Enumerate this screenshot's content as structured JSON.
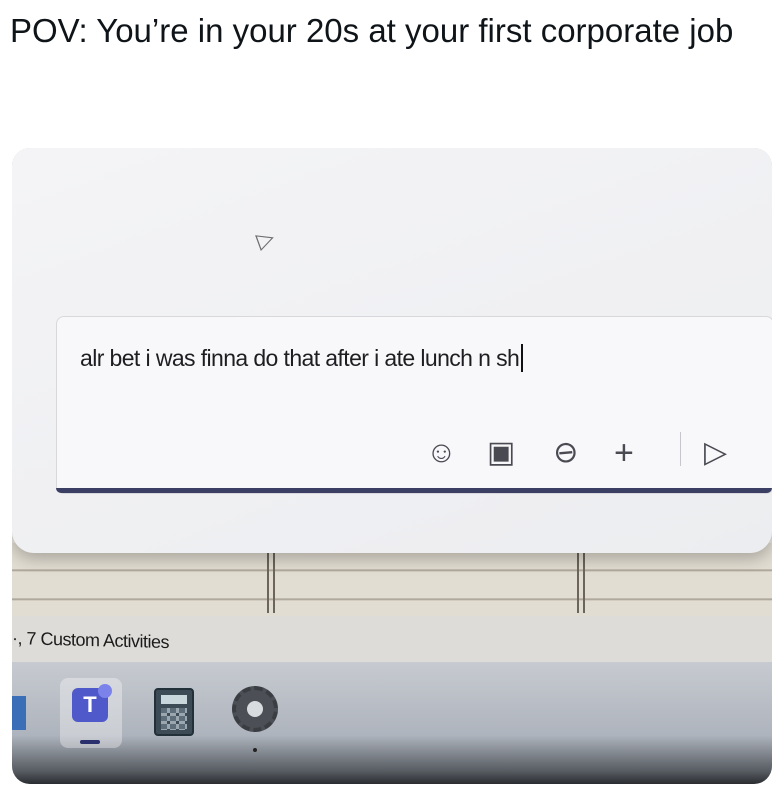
{
  "caption": "POV: You’re in your 20s at your first corporate job",
  "chat": {
    "message": "alr bet i was finna do that after i ate lunch n sh",
    "toolbar": {
      "emoji": "☺",
      "image": "▣",
      "attach": "⊘",
      "plus": "+",
      "send": "▷"
    }
  },
  "spreadsheet": {
    "status_text": "·, 7 Custom Activities"
  },
  "taskbar": {
    "items": [
      "microsoft-teams",
      "calculator",
      "settings"
    ]
  }
}
